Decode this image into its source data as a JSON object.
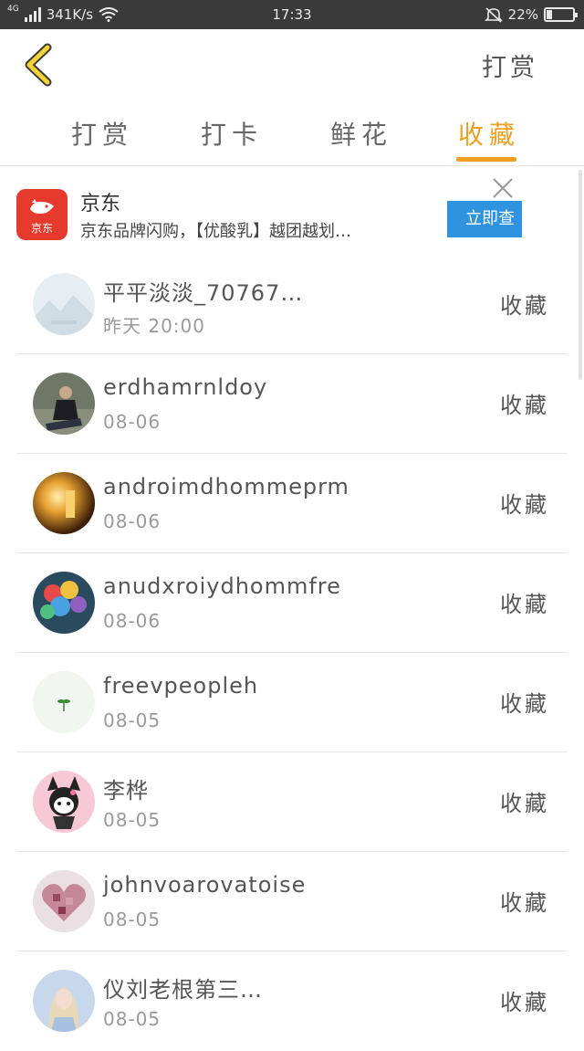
{
  "status_bar": {
    "network": "4G",
    "speed": "341K/s",
    "time": "17:33",
    "battery_percent": "22%",
    "battery_level": 0.22
  },
  "nav": {
    "action_label": "打赏"
  },
  "tabs": [
    {
      "label": "打赏",
      "active": false
    },
    {
      "label": "打卡",
      "active": false
    },
    {
      "label": "鲜花",
      "active": false
    },
    {
      "label": "收藏",
      "active": true
    }
  ],
  "colors": {
    "accent": "#f0a020",
    "cta_blue": "#2f93e0",
    "brand_red": "#e53a2d"
  },
  "ad": {
    "logo_text": "京东",
    "title": "京东",
    "description": "京东品牌闪购，【优酸乳】越团越划…",
    "cta_label": "立即查"
  },
  "list": [
    {
      "name": "平平淡淡_70767…",
      "time": "昨天 20:00",
      "action": "收藏"
    },
    {
      "name": "erdhamrnldoy",
      "time": "08-06",
      "action": "收藏"
    },
    {
      "name": "androimdhommeprm",
      "time": "08-06",
      "action": "收藏"
    },
    {
      "name": "anudxroiydhommfre",
      "time": "08-06",
      "action": "收藏"
    },
    {
      "name": "freevpeopleh",
      "time": "08-05",
      "action": "收藏"
    },
    {
      "name": "李桦",
      "time": "08-05",
      "action": "收藏"
    },
    {
      "name": "johnvoarovatoise",
      "time": "08-05",
      "action": "收藏"
    },
    {
      "name": "仪刘老根第三…",
      "time": "08-05",
      "action": "收藏"
    }
  ]
}
